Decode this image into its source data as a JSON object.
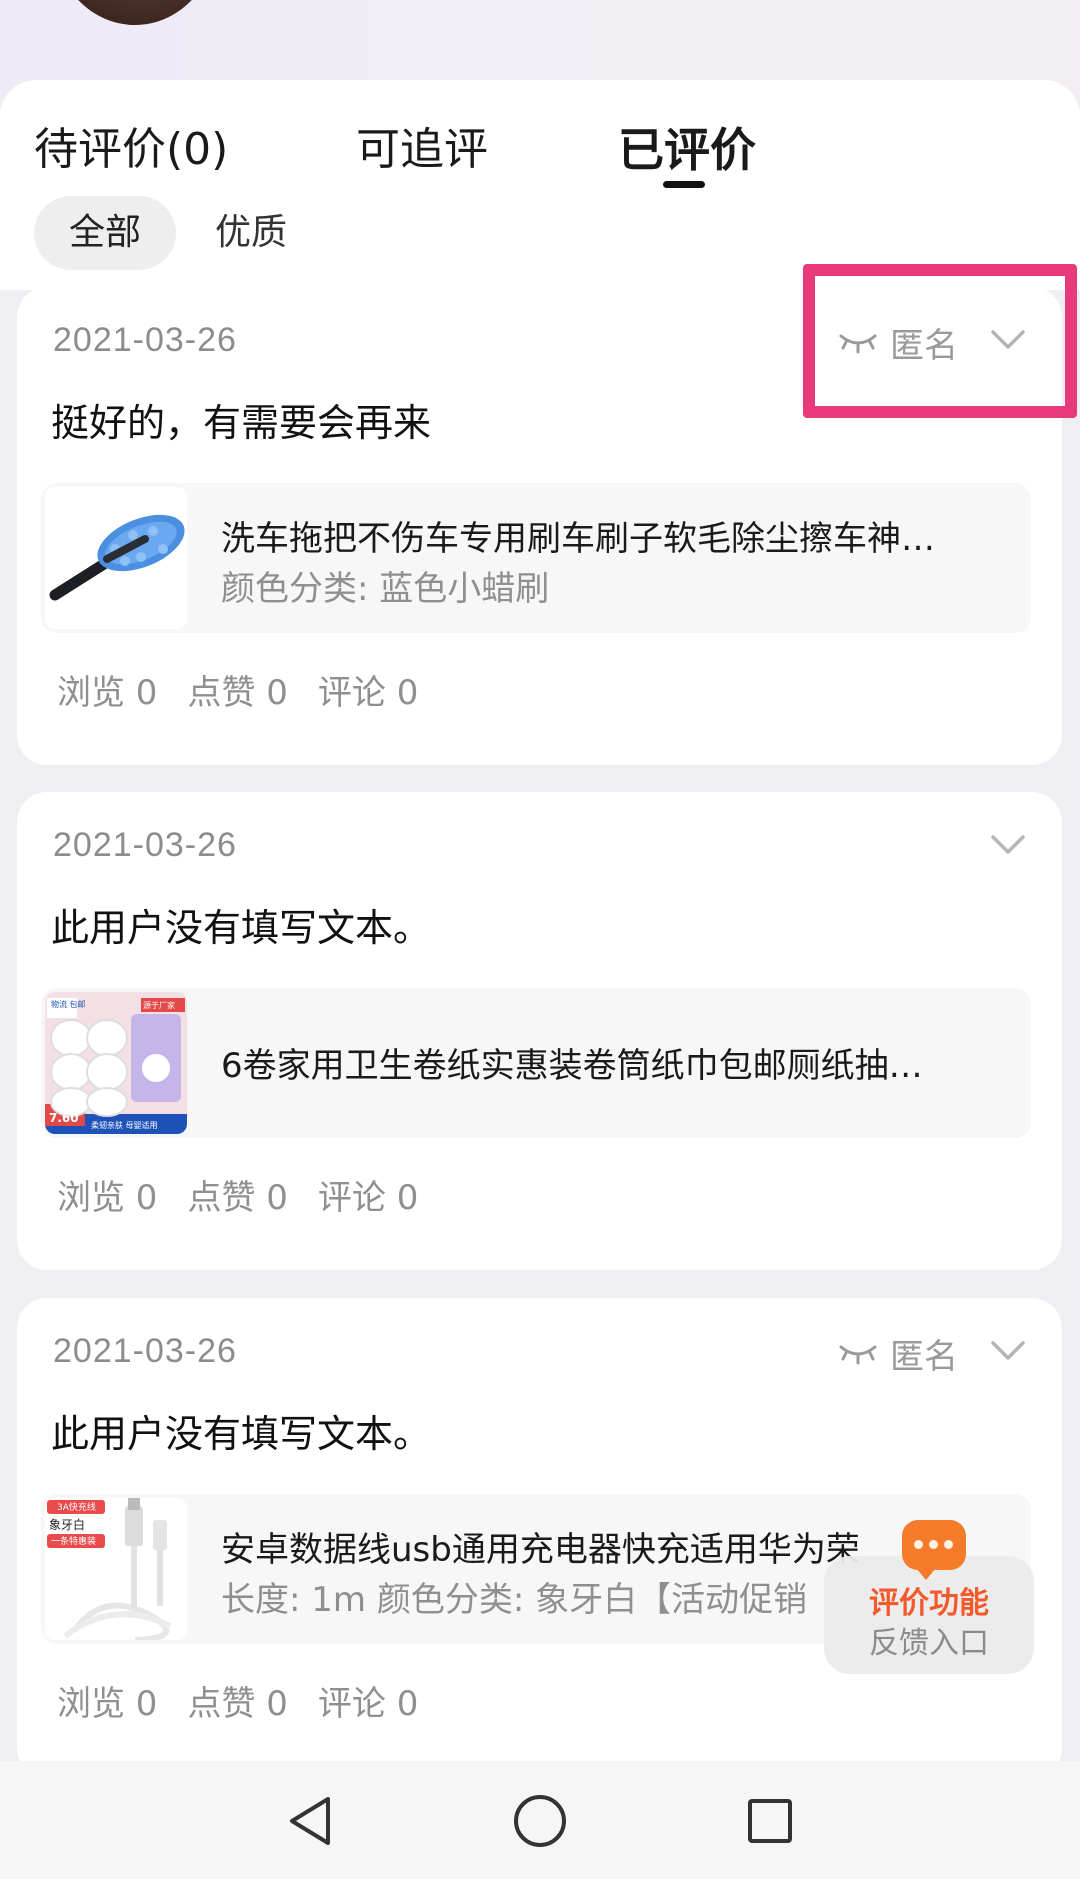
{
  "tabs": {
    "pending": "待评价(0)",
    "follow_up": "可追评",
    "reviewed": "已评价"
  },
  "filters": {
    "all": "全部",
    "quality": "优质"
  },
  "reviews": [
    {
      "date": "2021-03-26",
      "anonymous_label": "匿名",
      "text": "挺好的，有需要会再来",
      "product_title": "洗车拖把不伤车专用刷车刷子软毛除尘擦车神…",
      "product_spec": "颜色分类: 蓝色小蜡刷",
      "views": "浏览 0",
      "likes": "点赞 0",
      "comments": "评论 0"
    },
    {
      "date": "2021-03-26",
      "text": "此用户没有填写文本。",
      "product_title": "6卷家用卫生卷纸实惠装卷筒纸巾包邮厕纸抽…",
      "thumb_tags": [
        "物流 包邮",
        "源于厂家",
        "7.60",
        "柔韧亲肤 母婴适用"
      ],
      "views": "浏览 0",
      "likes": "点赞 0",
      "comments": "评论 0"
    },
    {
      "date": "2021-03-26",
      "anonymous_label": "匿名",
      "text": "此用户没有填写文本。",
      "product_title": "安卓数据线usb通用充电器快充适用华为荣",
      "product_spec": "长度: 1m 颜色分类: 象牙白【活动促销",
      "thumb_tags": [
        "3A快充线",
        "象牙白",
        "一条特惠装"
      ],
      "views": "浏览 0",
      "likes": "点赞 0",
      "comments": "评论 0"
    }
  ],
  "feedback": {
    "line1": "评价功能",
    "line2": "反馈入口"
  },
  "colors": {
    "highlight": "#e8397a",
    "feedback_accent": "#f2592b"
  }
}
